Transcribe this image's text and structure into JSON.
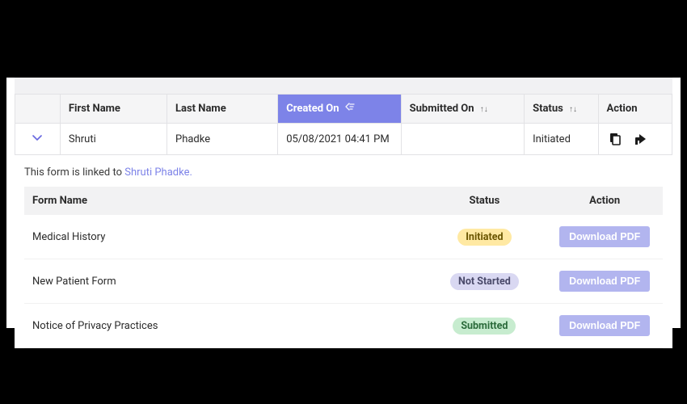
{
  "columns": {
    "first_name": "First Name",
    "last_name": "Last Name",
    "created_on": "Created On",
    "submitted_on": "Submitted On",
    "status": "Status",
    "action": "Action"
  },
  "row": {
    "first_name": "Shruti",
    "last_name": "Phadke",
    "created_on": "05/08/2021 04:41 PM",
    "submitted_on": "",
    "status": "Initiated"
  },
  "linked_prefix": "This form is linked to ",
  "linked_name": "Shruti Phadke.",
  "sub_columns": {
    "form_name": "Form Name",
    "status": "Status",
    "action": "Action"
  },
  "forms": [
    {
      "name": "Medical History",
      "status": "Initiated",
      "badge": "yellow"
    },
    {
      "name": "New Patient Form",
      "status": "Not Started",
      "badge": "purple"
    },
    {
      "name": "Notice of Privacy Practices",
      "status": "Submitted",
      "badge": "green"
    }
  ],
  "download_label": "Download PDF"
}
